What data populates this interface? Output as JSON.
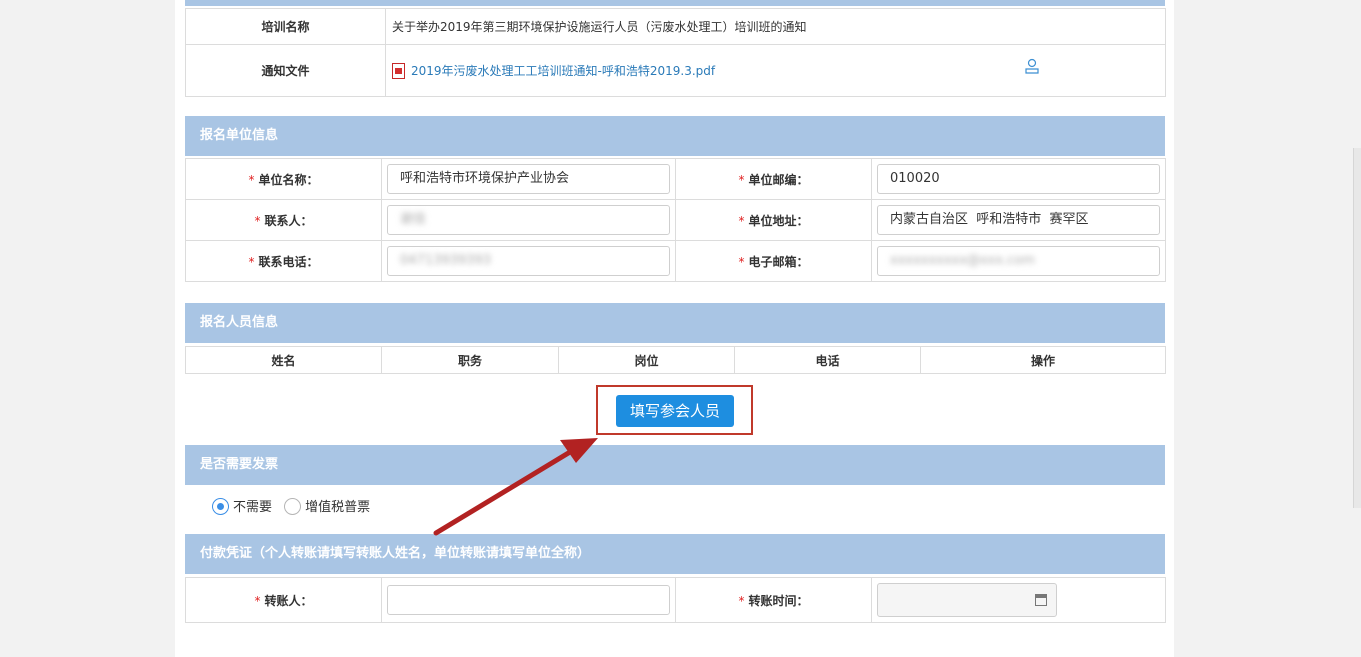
{
  "training": {
    "name_label": "培训名称",
    "name_value": "关于举办2019年第三期环境保护设施运行人员（污废水处理工）培训班的通知",
    "file_label": "通知文件",
    "file_name": "2019年污废水处理工工培训班通知-呼和浩特2019.3.pdf",
    "download_icon": "download-icon"
  },
  "unit_section": {
    "title": "报名单位信息",
    "required_mark": "*",
    "unit_name_label": "单位名称：",
    "unit_name_value": "呼和浩特市环境保护产业协会",
    "postcode_label": "单位邮编：",
    "postcode_value": "010020",
    "contact_label": "联系人：",
    "contact_value": "谢佳",
    "address_label": "单位地址：",
    "address_value": "内蒙古自治区  呼和浩特市  赛罕区",
    "phone_label": "联系电话：",
    "phone_value": "04713939393",
    "email_label": "电子邮箱：",
    "email_value": "xxxxxxxxxx@xxx.com"
  },
  "people_section": {
    "title": "报名人员信息",
    "columns": [
      "姓名",
      "职务",
      "岗位",
      "电话",
      "操作"
    ],
    "add_button": "填写参会人员"
  },
  "invoice_section": {
    "title": "是否需要发票",
    "option_no": "不需要",
    "option_vat": "增值税普票",
    "selected": "不需要"
  },
  "payment_section": {
    "title": "付款凭证（个人转账请填写转账人姓名，单位转账请填写单位全称）",
    "payer_label": "转账人：",
    "payer_value": "",
    "time_label": "转账时间：",
    "time_value": "",
    "calendar_icon": "calendar-icon"
  },
  "colors": {
    "section_header": "#a9c5e4",
    "primary_button": "#1e8ee0",
    "highlight_frame": "#c0392b",
    "required": "#e02020",
    "link": "#2a7ab8"
  }
}
